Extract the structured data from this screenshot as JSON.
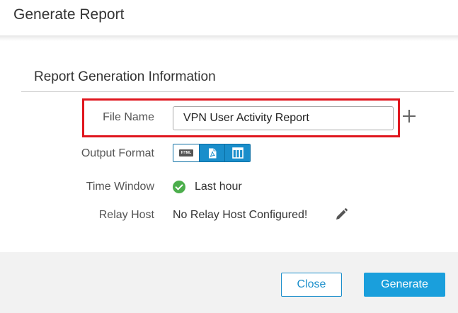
{
  "dialog": {
    "title": "Generate Report",
    "section_title": "Report Generation Information"
  },
  "fields": {
    "file_name": {
      "label": "File Name",
      "value": "VPN User Activity Report"
    },
    "output_format": {
      "label": "Output Format",
      "options": [
        "HTML",
        "PDF",
        "CSV"
      ],
      "html_icon_text": "HTML"
    },
    "time_window": {
      "label": "Time Window",
      "value": "Last hour"
    },
    "relay_host": {
      "label": "Relay Host",
      "value": "No Relay Host Configured!"
    }
  },
  "icons": {
    "add": "plus-icon",
    "html": "html-file-icon",
    "pdf": "pdf-file-icon",
    "csv": "csv-columns-icon",
    "check": "check-circle-icon",
    "edit": "pencil-icon"
  },
  "colors": {
    "highlight": "#e0161e",
    "primary": "#1a9fdc",
    "format_active": "#1a8ecb",
    "success": "#4cae4c"
  },
  "footer": {
    "close_label": "Close",
    "generate_label": "Generate"
  }
}
